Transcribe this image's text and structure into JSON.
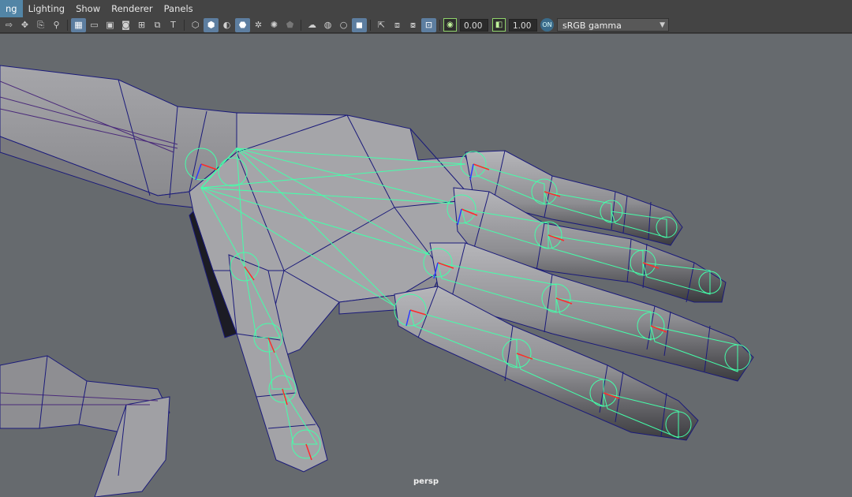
{
  "menu": {
    "items": [
      {
        "label": "ng",
        "active": true
      },
      {
        "label": "Lighting",
        "active": false
      },
      {
        "label": "Show",
        "active": false
      },
      {
        "label": "Renderer",
        "active": false
      },
      {
        "label": "Panels",
        "active": false
      }
    ]
  },
  "toolbar": {
    "exposure_value": "0.00",
    "gamma_value": "1.00",
    "color_space": "sRGB gamma"
  },
  "viewport": {
    "camera_label": "persp"
  },
  "colors": {
    "wire": "#1a1a7a",
    "mesh": "#9b9b9f",
    "bones": "#44ffaa",
    "background": "#666a6e"
  }
}
